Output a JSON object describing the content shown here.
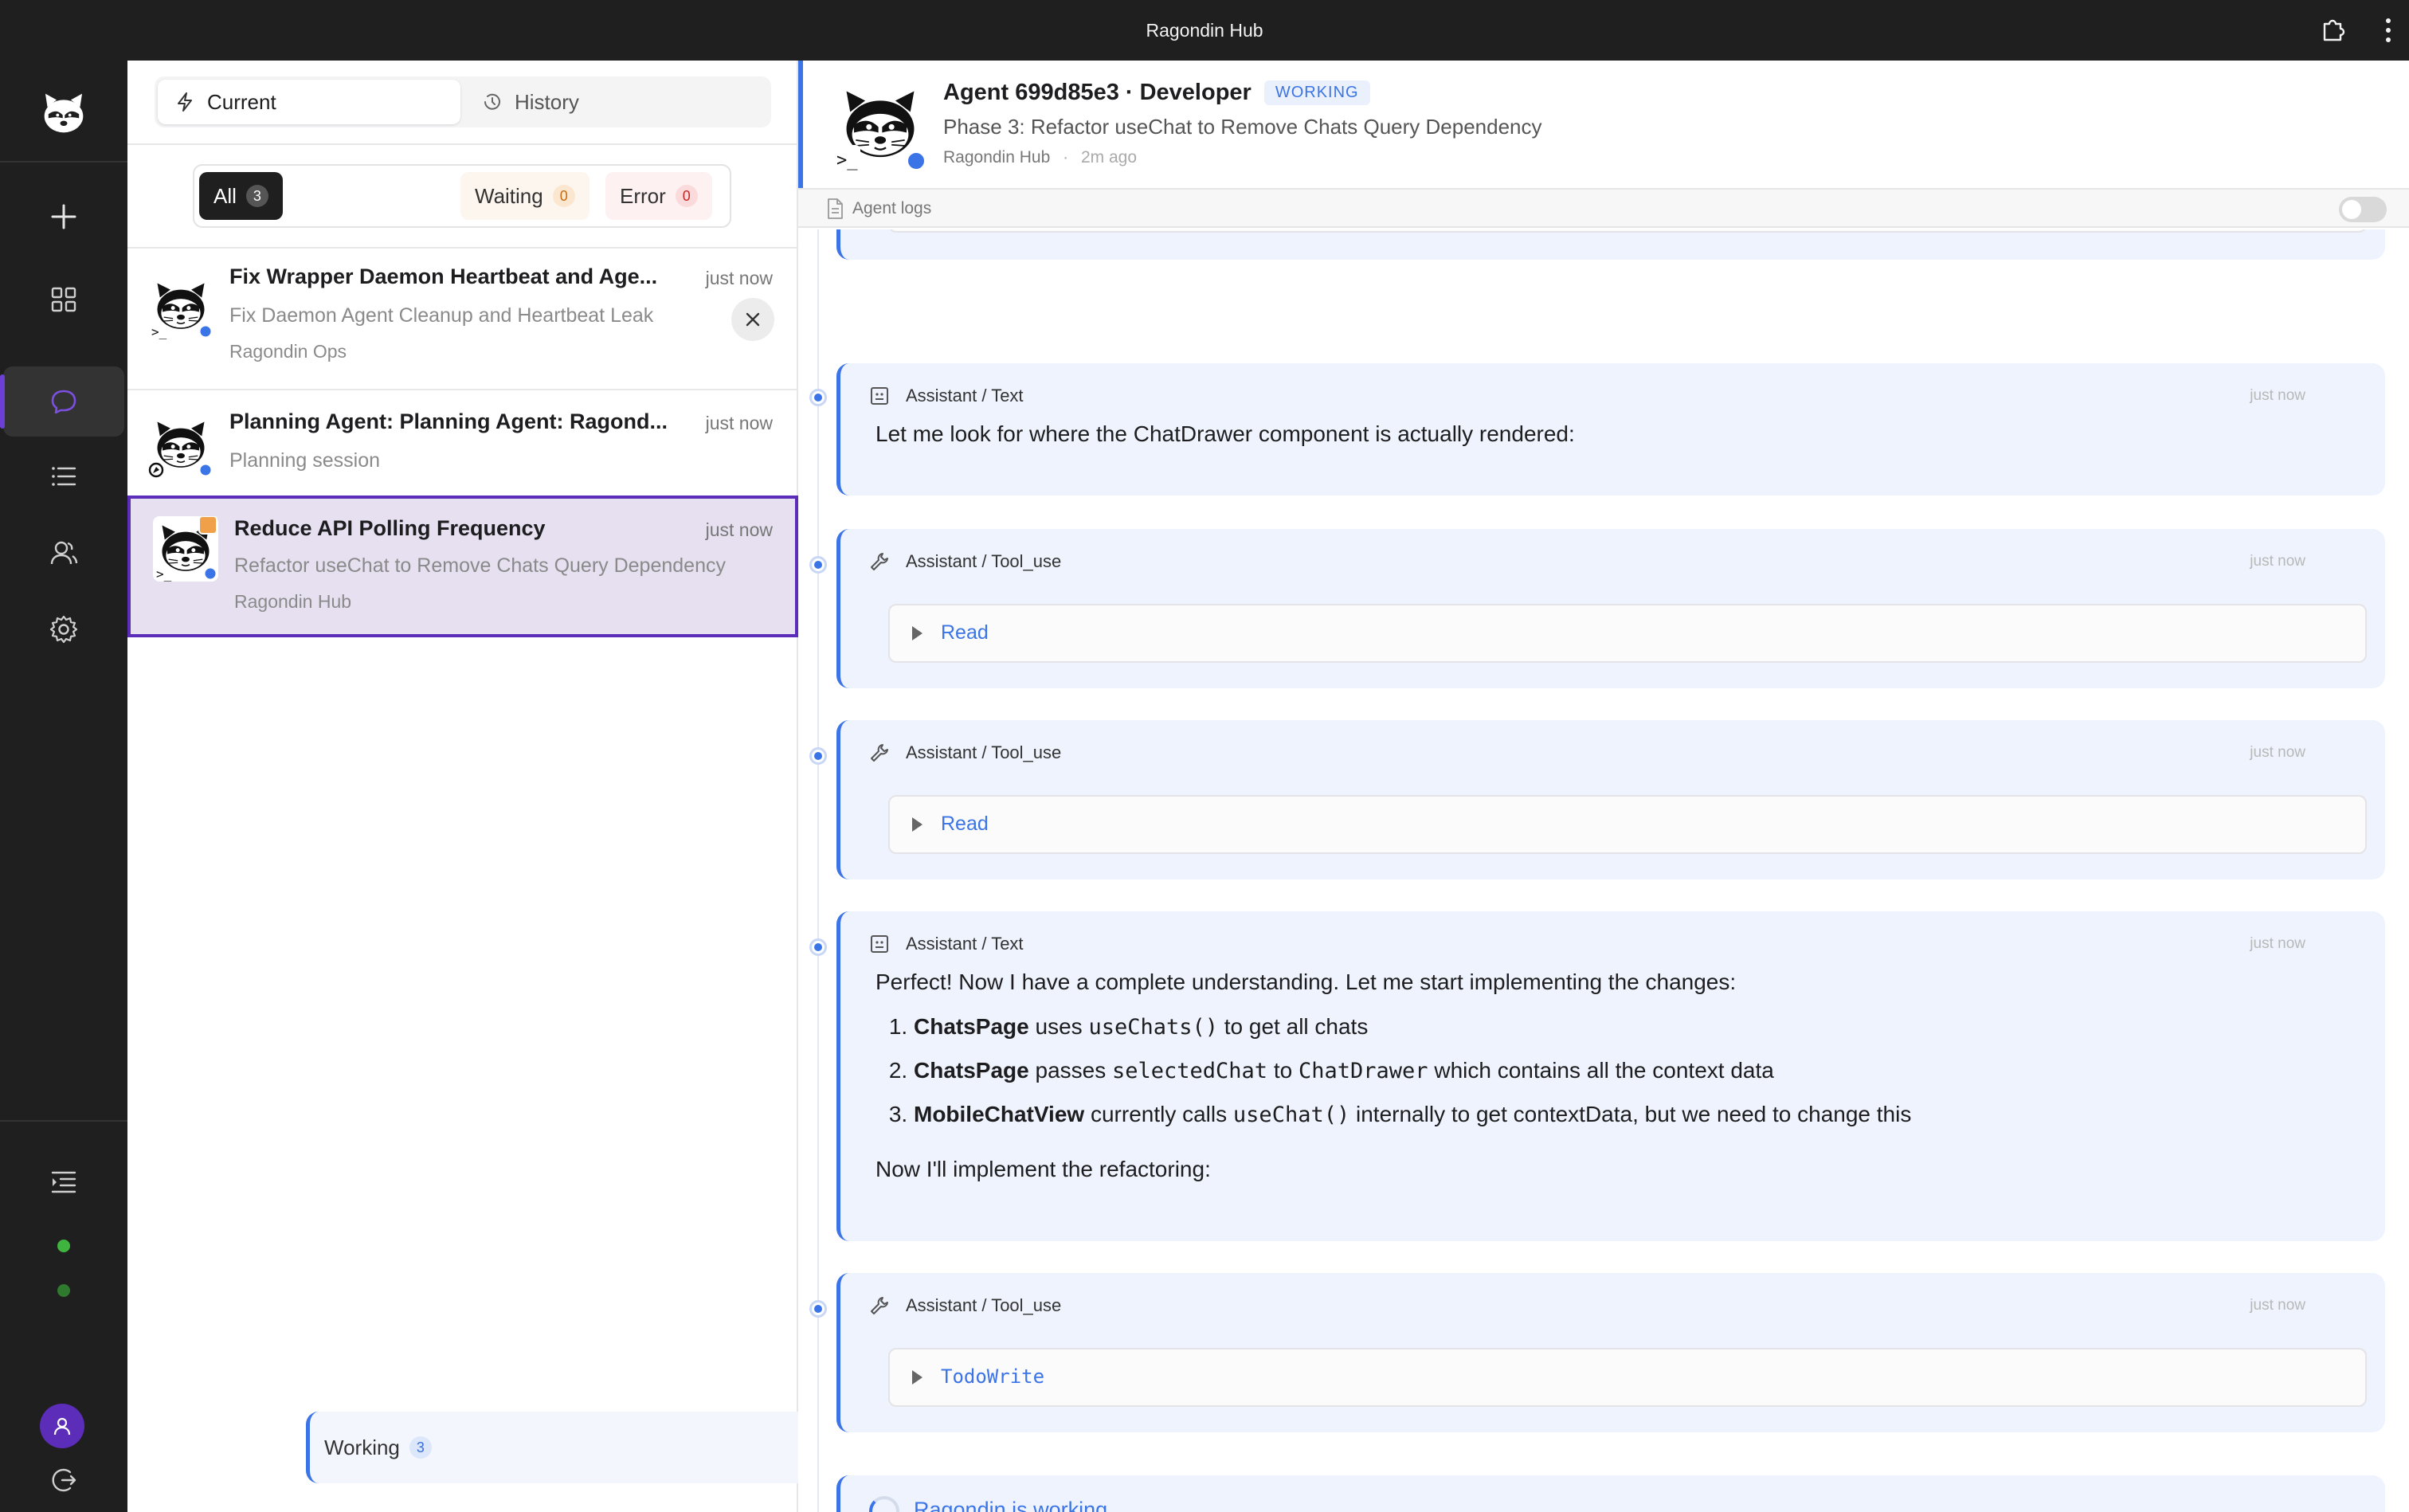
{
  "window": {
    "title": "Ragondin Hub"
  },
  "tabs": {
    "current": "Current",
    "history": "History"
  },
  "filters": [
    {
      "label": "All",
      "count": "3"
    },
    {
      "label": "Working",
      "count": "3"
    },
    {
      "label": "Waiting",
      "count": "0"
    },
    {
      "label": "Error",
      "count": "0"
    }
  ],
  "sessions": [
    {
      "title": "Fix Wrapper Daemon Heartbeat and Age...",
      "time": "just now",
      "subtitle": "Fix Daemon Agent Cleanup and Heartbeat Leak",
      "project": "Ragondin Ops"
    },
    {
      "title": "Planning Agent: Planning Agent: Ragond...",
      "time": "just now",
      "subtitle": "Planning session"
    },
    {
      "title": "Reduce API Polling Frequency",
      "time": "just now",
      "subtitle": "Refactor useChat to Remove Chats Query Dependency",
      "project": "Ragondin Hub"
    }
  ],
  "header": {
    "title": "Agent 699d85e3 · Developer",
    "status": "WORKING",
    "subtitle": "Phase 3: Refactor useChat to Remove Chats Query Dependency",
    "project": "Ragondin Hub",
    "sep": "·",
    "time": "2m ago"
  },
  "logbar": {
    "label": "Agent logs"
  },
  "messages": {
    "m1": {
      "head": "Assistant / Text",
      "time": "just now",
      "text": "Let me look for where the ChatDrawer component is actually rendered:"
    },
    "m2": {
      "head": "Assistant / Tool_use",
      "time": "just now",
      "tool": "Read"
    },
    "m3": {
      "head": "Assistant / Tool_use",
      "time": "just now",
      "tool": "Read"
    },
    "m4": {
      "head": "Assistant / Text",
      "time": "just now",
      "intro": "Perfect! Now I have a complete understanding. Let me start implementing the changes:",
      "items": [
        {
          "bold": "ChatsPage",
          "t1": "uses",
          "code1": "useChats()",
          "t2": "to get all chats"
        },
        {
          "bold": "ChatsPage",
          "t1": "passes",
          "code1": "selectedChat",
          "t2": "to",
          "code2": "ChatDrawer",
          "t3": "which contains all the context data"
        },
        {
          "bold": "MobileChatView",
          "t1": "currently calls",
          "code1": "useChat()",
          "t2": "internally to get contextData, but we need to change this"
        }
      ],
      "outro": "Now I'll implement the refactoring:"
    },
    "m5": {
      "head": "Assistant / Tool_use",
      "time": "just now",
      "tool": "TodoWrite"
    }
  },
  "working": {
    "text": "Ragondin is working..."
  },
  "colors": {
    "accent": "#3b74e6",
    "selected": "#5b2db8",
    "dark": "#1f1f1f",
    "online": "#3fb43f"
  }
}
